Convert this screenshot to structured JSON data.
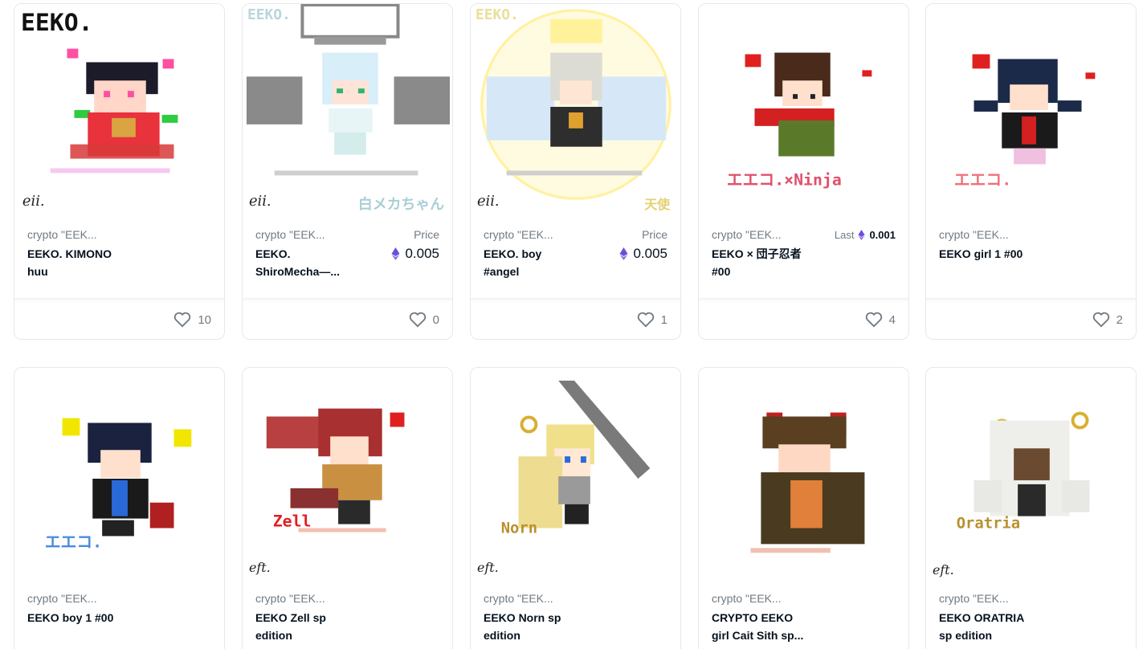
{
  "colors": {
    "eth_purple": "#6b4fd8",
    "muted": "#707a83",
    "text": "#04111d",
    "border": "#e5e8eb"
  },
  "cards": [
    {
      "collection": "crypto \"EEK...",
      "name_lines": [
        "EEKO. KIMONO",
        "huu"
      ],
      "price_type": "none",
      "price_label": "",
      "price_value": "",
      "likes": "10",
      "art": "kimono-girl-pixel-art",
      "watermark": "EEKO."
    },
    {
      "collection": "crypto \"EEK...",
      "name_lines": [
        "EEKO.",
        "ShiroMecha—..."
      ],
      "price_type": "price",
      "price_label": "Price",
      "price_value": "0.005",
      "likes": "0",
      "art": "shiromecha-pixel-art",
      "watermark": "EEKO.",
      "caption": "白メカちゃん"
    },
    {
      "collection": "crypto \"EEK...",
      "name_lines": [
        "EEKO. boy",
        "#angel"
      ],
      "price_type": "price",
      "price_label": "Price",
      "price_value": "0.005",
      "likes": "1",
      "art": "angel-boy-pixel-art",
      "watermark": "EEKO.",
      "caption": "天使"
    },
    {
      "collection": "crypto \"EEK...",
      "name_lines": [
        "EEKO × 団子忍者",
        "#00"
      ],
      "price_type": "last",
      "price_label": "Last",
      "price_value": "0.001",
      "likes": "4",
      "art": "ninja-pixel-art",
      "caption": "エエコ.×Ninja"
    },
    {
      "collection": "crypto \"EEK...",
      "name_lines": [
        "EEKO girl 1 #00",
        ""
      ],
      "price_type": "none",
      "price_label": "",
      "price_value": "",
      "likes": "2",
      "art": "girl-pixel-art",
      "caption": "エエコ."
    },
    {
      "collection": "crypto \"EEK...",
      "name_lines": [
        "EEKO boy 1 #00",
        ""
      ],
      "price_type": "none",
      "price_label": "",
      "price_value": "",
      "likes": "",
      "art": "boy-pixel-art",
      "caption": "エエコ."
    },
    {
      "collection": "crypto \"EEK...",
      "name_lines": [
        "EEKO Zell sp",
        "edition"
      ],
      "price_type": "none",
      "price_label": "",
      "price_value": "",
      "likes": "",
      "art": "zell-pixel-art",
      "caption": "Zell"
    },
    {
      "collection": "crypto \"EEK...",
      "name_lines": [
        "EEKO Norn sp",
        "edition"
      ],
      "price_type": "none",
      "price_label": "",
      "price_value": "",
      "likes": "",
      "art": "norn-pixel-art",
      "caption": "Norn"
    },
    {
      "collection": "crypto \"EEK...",
      "name_lines": [
        "CRYPTO EEKO",
        "girl Cait Sith sp..."
      ],
      "price_type": "none",
      "price_label": "",
      "price_value": "",
      "likes": "",
      "art": "cait-sith-pixel-art"
    },
    {
      "collection": "crypto \"EEK...",
      "name_lines": [
        "EEKO ORATRIA",
        "sp edition"
      ],
      "price_type": "none",
      "price_label": "",
      "price_value": "",
      "likes": "",
      "art": "oratria-pixel-art",
      "caption": "Oratria"
    }
  ]
}
